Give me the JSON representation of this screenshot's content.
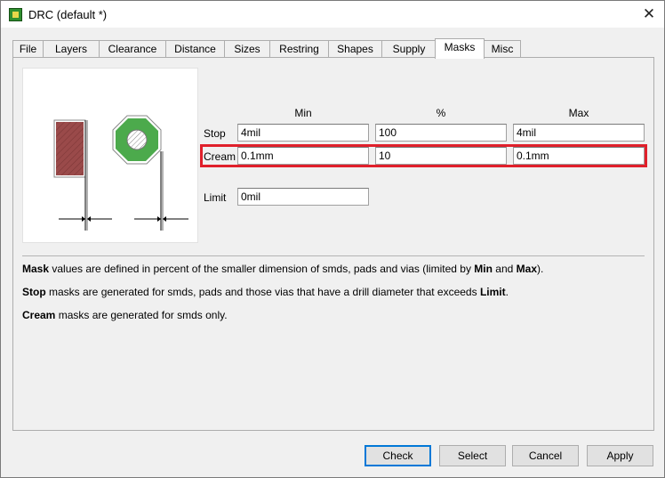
{
  "window": {
    "title": "DRC (default *)"
  },
  "tabs": [
    "File",
    "Layers",
    "Clearance",
    "Distance",
    "Sizes",
    "Restring",
    "Shapes",
    "Supply",
    "Masks",
    "Misc"
  ],
  "active_tab": "Masks",
  "masks": {
    "columns": {
      "min": "Min",
      "percent": "%",
      "max": "Max"
    },
    "stop": {
      "label": "Stop",
      "min": "4mil",
      "percent": "100",
      "max": "4mil"
    },
    "cream": {
      "label": "Cream",
      "min": "0.1mm",
      "percent": "10",
      "max": "0.1mm"
    },
    "limit": {
      "label": "Limit",
      "value": "0mil"
    }
  },
  "help": {
    "line1": {
      "b1": "Mask",
      "t1": " values are defined in percent of the smaller dimension of smds, pads and vias (limited by ",
      "b2": "Min",
      "t2": " and ",
      "b3": "Max",
      "t3": ")."
    },
    "line2": {
      "b1": "Stop",
      "t1": " masks are generated for smds, pads and those vias that have a drill diameter that exceeds ",
      "b2": "Limit",
      "t2": "."
    },
    "line3": {
      "b1": "Cream",
      "t1": " masks are generated for smds only."
    }
  },
  "buttons": {
    "check": "Check",
    "select": "Select",
    "cancel": "Cancel",
    "apply": "Apply"
  },
  "colors": {
    "highlight": "#e0202b",
    "smd": "#9a4a4a",
    "pad": "#4caa4c",
    "focus": "#0078d7"
  }
}
